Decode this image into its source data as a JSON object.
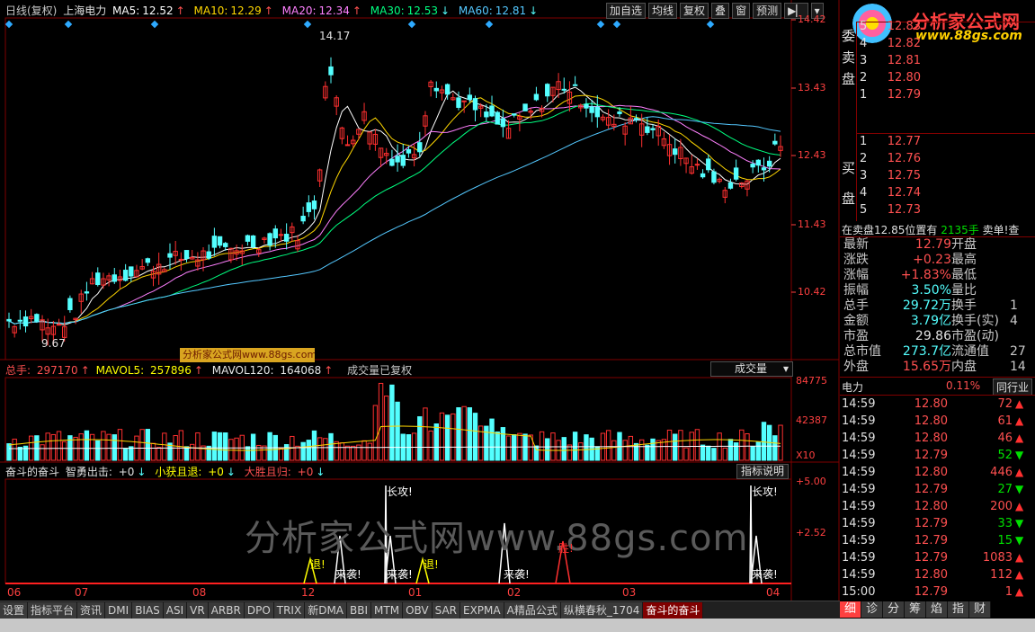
{
  "header": {
    "period": "日线(复权)",
    "stock": "上海电力",
    "ma5": {
      "label": "MA5:",
      "value": "12.52"
    },
    "ma10": {
      "label": "MA10:",
      "value": "12.29"
    },
    "ma20": {
      "label": "MA20:",
      "value": "12.34"
    },
    "ma30": {
      "label": "MA30:",
      "value": "12.53"
    },
    "ma60": {
      "label": "MA60:",
      "value": "12.81"
    }
  },
  "toolbar": {
    "add": "加自选",
    "avg": "均线",
    "fq": "复权",
    "overlay": "叠",
    "window": "窗",
    "predict": "预测"
  },
  "price_axis": [
    "14.42",
    "13.43",
    "12.43",
    "11.43",
    "10.42"
  ],
  "price_annotations": {
    "high": "14.17",
    "low": "9.67"
  },
  "watermark_small": "分析家公式网www.88gs.com",
  "watermark_big": "分析家公式网www.88gs.com",
  "logo": {
    "title": "分析家公式网",
    "url": "www.88gs.com"
  },
  "volume": {
    "label_total": "总手:",
    "total": "297170",
    "label_m5": "MAVOL5:",
    "m5": "257896",
    "label_m120": "MAVOL120:",
    "m120": "164068",
    "note": "成交量已复权",
    "select": "成交量",
    "axis": [
      "84775",
      "42387"
    ],
    "unit": "X10"
  },
  "indicator": {
    "name": "奋斗的奋斗",
    "l1_label": "智勇出击:",
    "l1_value": "+0",
    "l2_label": "小获且退:",
    "l2_value": "+0",
    "l3_label": "大胜且归:",
    "l3_value": "+0",
    "help": "指标说明",
    "axis": [
      "+5.00",
      "+2.52"
    ],
    "signals": [
      {
        "label": "长攻!",
        "color": "#ffffff"
      },
      {
        "label": "长攻!",
        "color": "#ffffff"
      },
      {
        "label": "退!",
        "color": "#ffff00"
      },
      {
        "label": "来袭!",
        "color": "#ffffff"
      },
      {
        "label": "来袭!",
        "color": "#ffffff"
      },
      {
        "label": "退!",
        "color": "#ffff00"
      },
      {
        "label": "来袭!",
        "color": "#ffffff"
      },
      {
        "label": "胜!",
        "color": "#ff3030"
      },
      {
        "label": "来袭!",
        "color": "#ffffff"
      }
    ]
  },
  "x_axis": [
    "06",
    "07",
    "08",
    "12",
    "01",
    "02",
    "03",
    "04"
  ],
  "tabs": [
    "设置",
    "指标平台",
    "资讯",
    "DMI",
    "BIAS",
    "ASI",
    "VR",
    "ARBR",
    "DPO",
    "TRIX",
    "新DMA",
    "BBI",
    "MTM",
    "OBV",
    "SAR",
    "EXPMA",
    "A精品公式",
    "纵横春秋_1704",
    "奋斗的奋斗"
  ],
  "right_tabs": [
    "细",
    "诊",
    "分",
    "筹",
    "焰",
    "指",
    "财"
  ],
  "orderbook": {
    "sell_label": [
      "委",
      "卖",
      "盘"
    ],
    "buy_label": [
      "买",
      "盘"
    ],
    "sell": [
      {
        "level": "5",
        "price": "12.83",
        "vol": ""
      },
      {
        "level": "4",
        "price": "12.82",
        "vol": ""
      },
      {
        "level": "3",
        "price": "12.81",
        "vol": ""
      },
      {
        "level": "2",
        "price": "12.80",
        "vol": ""
      },
      {
        "level": "1",
        "price": "12.79",
        "vol": ""
      }
    ],
    "buy": [
      {
        "level": "1",
        "price": "12.77",
        "vol": ""
      },
      {
        "level": "2",
        "price": "12.76",
        "vol": ""
      },
      {
        "level": "3",
        "price": "12.75",
        "vol": ""
      },
      {
        "level": "4",
        "price": "12.74",
        "vol": ""
      },
      {
        "level": "5",
        "price": "12.73",
        "vol": ""
      }
    ]
  },
  "info_line": {
    "text": "在卖盘12.85位置有",
    "vol": "2135手",
    "tail": "卖单!查"
  },
  "stats": [
    {
      "l1": "最新",
      "v1": "12.79",
      "c1": "#ff5050",
      "l2": "开盘",
      "v2": ""
    },
    {
      "l1": "涨跌",
      "v1": "+0.23",
      "c1": "#ff5050",
      "l2": "最高",
      "v2": ""
    },
    {
      "l1": "涨幅",
      "v1": "+1.83%",
      "c1": "#ff5050",
      "l2": "最低",
      "v2": ""
    },
    {
      "l1": "振幅",
      "v1": "3.50%",
      "c1": "#54ffff",
      "l2": "量比",
      "v2": ""
    },
    {
      "l1": "总手",
      "v1": "29.72万",
      "c1": "#54ffff",
      "l2": "换手",
      "v2": "1"
    },
    {
      "l1": "金额",
      "v1": "3.79亿",
      "c1": "#54ffff",
      "l2": "换手(实)",
      "v2": "4"
    },
    {
      "l1": "市盈",
      "v1": "29.86",
      "c1": "#e0e0e0",
      "l2": "市盈(动)",
      "v2": ""
    },
    {
      "l1": "总市值",
      "v1": "273.7亿",
      "c1": "#54ffff",
      "l2": "流通值",
      "v2": "27"
    },
    {
      "l1": "外盘",
      "v1": "15.65万",
      "c1": "#ff5050",
      "l2": "内盘",
      "v2": "14"
    }
  ],
  "industry": {
    "name": "电力",
    "pct": "0.11%",
    "btn": "同行业"
  },
  "ticks": [
    {
      "t": "14:59",
      "p": "12.80",
      "v": "72",
      "dir": "up"
    },
    {
      "t": "14:59",
      "p": "12.80",
      "v": "61",
      "dir": "up"
    },
    {
      "t": "14:59",
      "p": "12.80",
      "v": "46",
      "dir": "up"
    },
    {
      "t": "14:59",
      "p": "12.79",
      "v": "52",
      "dir": "down"
    },
    {
      "t": "14:59",
      "p": "12.80",
      "v": "446",
      "dir": "up"
    },
    {
      "t": "14:59",
      "p": "12.79",
      "v": "27",
      "dir": "down"
    },
    {
      "t": "14:59",
      "p": "12.80",
      "v": "200",
      "dir": "up"
    },
    {
      "t": "14:59",
      "p": "12.79",
      "v": "33",
      "dir": "down"
    },
    {
      "t": "14:59",
      "p": "12.79",
      "v": "15",
      "dir": "down"
    },
    {
      "t": "14:59",
      "p": "12.79",
      "v": "1083",
      "dir": "up"
    },
    {
      "t": "14:59",
      "p": "12.80",
      "v": "112",
      "dir": "up"
    },
    {
      "t": "15:00",
      "p": "12.79",
      "v": "1",
      "dir": "up"
    }
  ],
  "colors": {
    "up": "#ff3030",
    "down": "#54ffff",
    "ma5": "#ffffff",
    "ma10": "#ffd700",
    "ma20": "#ff80ff",
    "ma30": "#00ff80",
    "ma60": "#54c8ff"
  }
}
